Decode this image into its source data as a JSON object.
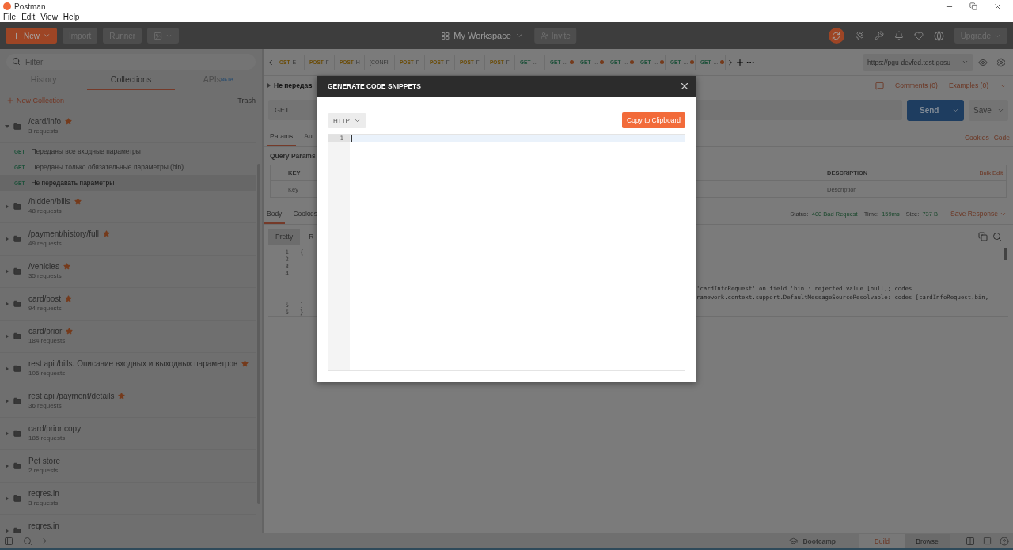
{
  "window": {
    "title": "Postman",
    "menu": [
      "File",
      "Edit",
      "View",
      "Help"
    ]
  },
  "header": {
    "new_button": "New",
    "buttons": [
      "Import",
      "Runner"
    ],
    "workspace": "My Workspace",
    "invite": "Invite",
    "upgrade": "Upgrade"
  },
  "sidebar": {
    "filter": {
      "placeholder": "Filter"
    },
    "tabs": [
      {
        "label": "History",
        "selected": false
      },
      {
        "label": "Collections",
        "selected": true
      },
      {
        "label": "APIs",
        "badge": "BETA",
        "selected": false
      }
    ],
    "new_collection": "New Collection",
    "trash": "Trash",
    "collections": [
      {
        "name": "/card/info",
        "count": "3 requests",
        "starred": true,
        "expanded": true,
        "children": [
          {
            "method": "GET",
            "name": "Переданы все входные параметры",
            "selected": false
          },
          {
            "method": "GET",
            "name": "Переданы только обязательные параметры (bin)",
            "selected": false
          },
          {
            "method": "GET",
            "name": "Не передавать параметры",
            "selected": true
          }
        ]
      },
      {
        "name": "/hidden/bills",
        "count": "48 requests",
        "starred": true,
        "expanded": false
      },
      {
        "name": "/payment/history/full",
        "count": "49 requests",
        "starred": true,
        "expanded": false
      },
      {
        "name": "/vehicles",
        "count": "35 requests",
        "starred": true,
        "expanded": false
      },
      {
        "name": "card/post",
        "count": "94 requests",
        "starred": true,
        "expanded": false
      },
      {
        "name": "card/prior",
        "count": "184 requests",
        "starred": true,
        "expanded": false
      },
      {
        "name": "rest api /bills. Описание входных и выходных параметров",
        "count": "106 requests",
        "starred": true,
        "expanded": false
      },
      {
        "name": "rest api /payment/details",
        "count": "36 requests",
        "starred": true,
        "expanded": false
      },
      {
        "name": "card/prior copy",
        "count": "185 requests",
        "starred": false,
        "expanded": false
      },
      {
        "name": "Pet store",
        "count": "2 requests",
        "starred": false,
        "expanded": false
      },
      {
        "name": "reqres.in",
        "count": "3 requests",
        "starred": false,
        "expanded": false
      },
      {
        "name": "reqres.in",
        "starred": false,
        "expanded": false
      }
    ]
  },
  "request_tabs": [
    {
      "method": "OST",
      "name": "E",
      "modified": false
    },
    {
      "method": "POST",
      "name": "Г",
      "modified": false
    },
    {
      "method": "POST",
      "name": "Н",
      "modified": false
    },
    {
      "name": "[CONFI",
      "modified": false
    },
    {
      "method": "POST",
      "name": "Г",
      "modified": false
    },
    {
      "method": "POST",
      "name": "Г",
      "modified": false
    },
    {
      "method": "POST",
      "name": "Г",
      "modified": false
    },
    {
      "method": "POST",
      "name": "Г",
      "modified": false
    },
    {
      "method": "GET",
      "name": "...",
      "modified": false
    },
    {
      "method": "GET",
      "name": "...",
      "modified": true
    },
    {
      "method": "GET",
      "name": "...",
      "modified": true
    },
    {
      "method": "GET",
      "name": "...",
      "modified": true
    },
    {
      "method": "GET",
      "name": "...",
      "modified": true
    },
    {
      "method": "GET",
      "name": "...",
      "modified": true
    },
    {
      "method": "GET",
      "name": "...",
      "modified": true
    }
  ],
  "environment": "https://pgu-devfed.test.gosu",
  "request": {
    "name": "Не передав",
    "comments": "Comments (0)",
    "examples": "Examples (0)",
    "method": "GET",
    "send": "Send",
    "save": "Save",
    "tabs": [
      {
        "label": "Params",
        "selected": true
      },
      {
        "label": "Au",
        "selected": false
      }
    ],
    "links": [
      "Cookies",
      "Code"
    ],
    "query_title": "Query Params",
    "columns": [
      "KEY",
      "DESCRIPTION"
    ],
    "bulk_edit": "Bulk Edit",
    "key_placeholder": "Key",
    "description_placeholder": "Description"
  },
  "response": {
    "tabs": [
      {
        "label": "Body",
        "selected": true
      },
      {
        "label": "Cookies",
        "selected": false
      }
    ],
    "status_label": "Status:",
    "status": "400 Bad Request",
    "time_label": "Time:",
    "time": "159ms",
    "size_label": "Size:",
    "size": "737 B",
    "save_response": "Save Response",
    "views": [
      {
        "label": "Pretty",
        "selected": true
      },
      {
        "label": "R",
        "selected": false
      }
    ],
    "lines": [
      {
        "number": "1",
        "text": "{"
      },
      {
        "number": "2"
      },
      {
        "number": "3"
      },
      {
        "number": "4",
        "hidden_text": [
          "'cardInfoRequest' on field 'bin': rejected value [null]; codes",
          "ramework.context.support.DefaultMessageSourceResolvable: codes [cardInfoRequest.bin,"
        ]
      },
      {
        "number": "5",
        "text": "]"
      },
      {
        "number": "6",
        "text": "}"
      }
    ]
  },
  "modal": {
    "title": "GENERATE CODE SNIPPETS",
    "language": "HTTP",
    "copy_button": "Copy to Clipboard",
    "line_number": "1"
  },
  "status_bar": {
    "bootcamp": "Bootcamp",
    "modes": [
      {
        "label": "Build",
        "selected": true
      },
      {
        "label": "Browse",
        "selected": false
      }
    ]
  }
}
